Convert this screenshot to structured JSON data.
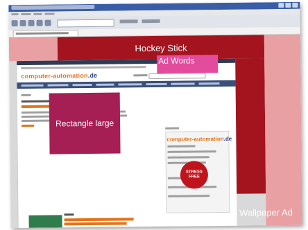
{
  "ads": {
    "hockey_stick": "Hockey Stick",
    "ad_words": "Ad Words",
    "rectangle_large": "Rectangle large",
    "wallpaper": "Wallpaper Ad"
  },
  "site": {
    "logo_main": "computer-automation",
    "logo_domain": ".de"
  },
  "badge": {
    "text": "STRESS FREE"
  },
  "colors": {
    "ad_red": "#a3141f",
    "ad_pink_light": "#e9a0a3",
    "ad_magenta": "#e34c9c",
    "ad_purple": "#a51f55",
    "logo_orange": "#e2741a"
  }
}
